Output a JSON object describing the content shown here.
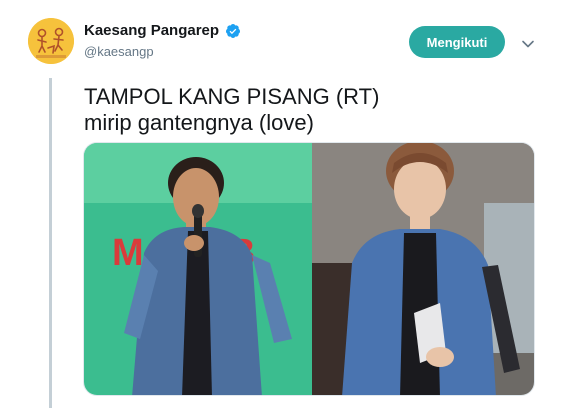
{
  "tweet": {
    "author": {
      "display_name": "Kaesang Pangarep",
      "handle": "@kaesangp",
      "verified": true,
      "avatar_icon": "avatar-illustration"
    },
    "follow_button": {
      "label": "Mengikuti"
    },
    "menu_icon": "chevron-down-icon",
    "text_lines": [
      "TAMPOL KANG PISANG (RT)",
      "mirip gantengnya (love)"
    ],
    "media": {
      "description_icon": "photo-collage",
      "banner_text": "MAKOB"
    }
  },
  "colors": {
    "follow_button_bg": "#2aa9a2",
    "verified_badge": "#1da1f2",
    "avatar_bg": "#f6c23c",
    "thread_line": "#c4cfd6"
  }
}
